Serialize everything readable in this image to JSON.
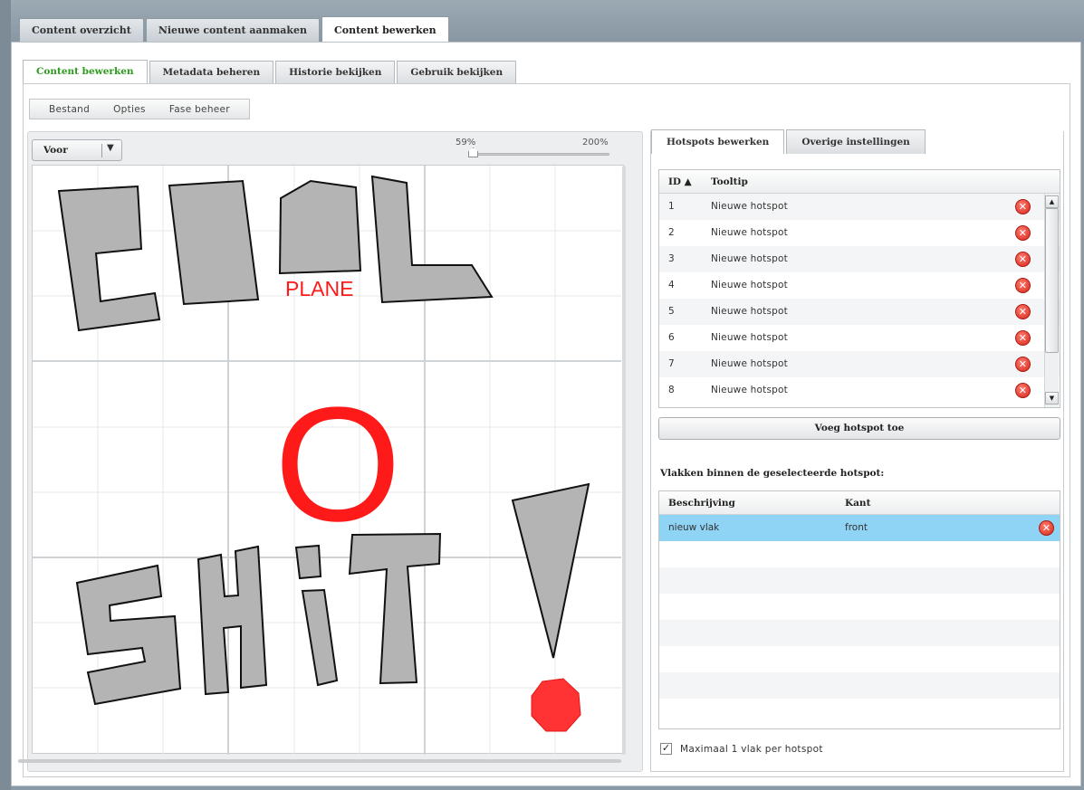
{
  "top_tabs": [
    {
      "label": "Content overzicht"
    },
    {
      "label": "Nieuwe content aanmaken"
    },
    {
      "label": "Content bewerken"
    }
  ],
  "sub_tabs": [
    {
      "label": "Content bewerken"
    },
    {
      "label": "Metadata beheren"
    },
    {
      "label": "Historie bekijken"
    },
    {
      "label": "Gebruik bekijken"
    }
  ],
  "menu": {
    "items": [
      {
        "label": "Bestand"
      },
      {
        "label": "Opties"
      },
      {
        "label": "Fase beheer"
      }
    ]
  },
  "editor": {
    "view_select": {
      "value": "Voor",
      "arrow": "▼"
    },
    "zoom": {
      "min_label": "59%",
      "max_label": "200%",
      "value": 0.0
    },
    "canvas_text": {
      "plane": "PLANE",
      "o": "O"
    },
    "colors": {
      "shape_fill": "#b4b4b4",
      "shape_stroke": "#111111",
      "red": "#ff1a1a"
    }
  },
  "right_panel": {
    "tabs": [
      {
        "label": "Hotspots bewerken"
      },
      {
        "label": "Overige instellingen"
      }
    ],
    "hotspot_table": {
      "headers": {
        "id": "ID ▲",
        "tooltip": "Tooltip"
      },
      "rows": [
        {
          "id": "1",
          "tooltip": "Nieuwe hotspot"
        },
        {
          "id": "2",
          "tooltip": "Nieuwe hotspot"
        },
        {
          "id": "3",
          "tooltip": "Nieuwe hotspot"
        },
        {
          "id": "4",
          "tooltip": "Nieuwe hotspot"
        },
        {
          "id": "5",
          "tooltip": "Nieuwe hotspot"
        },
        {
          "id": "6",
          "tooltip": "Nieuwe hotspot"
        },
        {
          "id": "7",
          "tooltip": "Nieuwe hotspot"
        },
        {
          "id": "8",
          "tooltip": "Nieuwe hotspot"
        }
      ],
      "scroll_up": "▲",
      "scroll_down": "▼"
    },
    "add_button": "Voeg hotspot toe",
    "faces_label": "Vlakken binnen de geselecteerde hotspot:",
    "faces_table": {
      "headers": {
        "description": "Beschrijving",
        "side": "Kant"
      },
      "rows": [
        {
          "description": "nieuw vlak",
          "side": "front",
          "selected": true
        }
      ]
    },
    "checkbox": {
      "label": "Maximaal 1 vlak per hotspot",
      "checked": true,
      "mark": "✓"
    },
    "delete_glyph": "✕"
  }
}
